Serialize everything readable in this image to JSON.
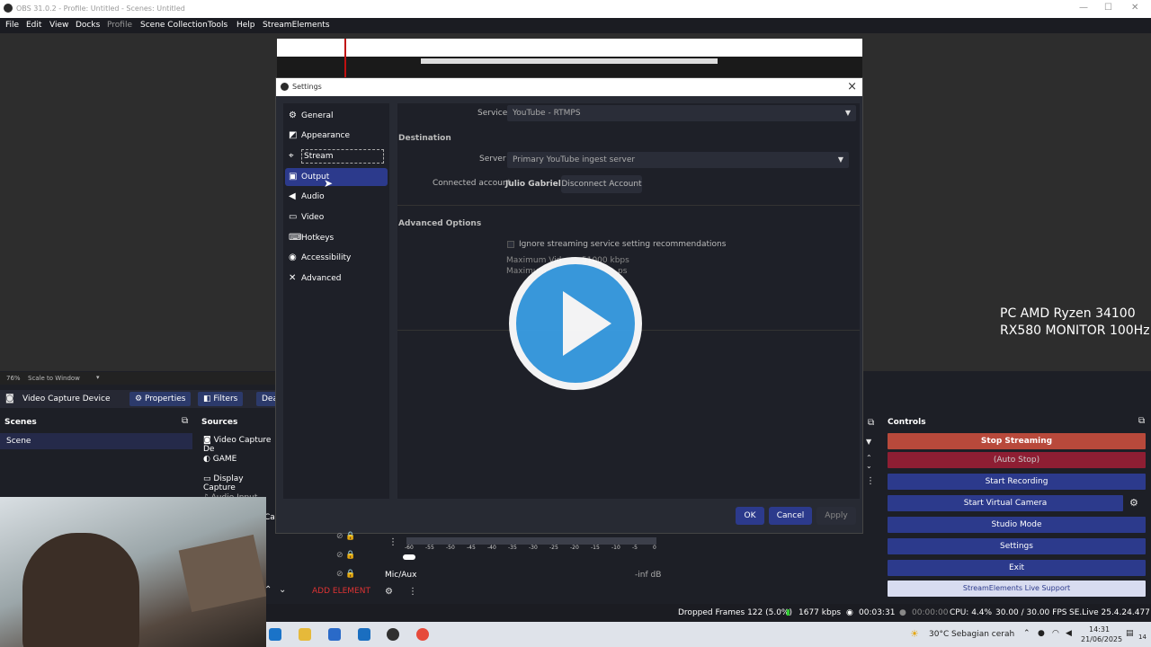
{
  "app": {
    "title": "OBS 31.0.2 - Profile: Untitled - Scenes: Untitled"
  },
  "menu": [
    "File",
    "Edit",
    "View",
    "Docks",
    "Profile",
    "Scene Collection",
    "Tools",
    "Help",
    "StreamElements"
  ],
  "preview": {
    "zoom": "76%",
    "scale_mode": "Scale to Window"
  },
  "overlay": {
    "line1": "PC AMD Ryzen 34100",
    "line2": "RX580 MONITOR 100Hz"
  },
  "source_toolbar": {
    "selected": "Video Capture Device",
    "properties": "Properties",
    "filters": "Filters",
    "deactivate": "Dea"
  },
  "scenes": {
    "title": "Scenes",
    "items": [
      "Scene"
    ]
  },
  "sources": {
    "title": "Sources",
    "items": [
      "Video Capture De",
      "GAME",
      "Display Capture",
      "Audio Input Capt",
      "Ca"
    ]
  },
  "settings": {
    "title": "Settings",
    "nav": [
      "General",
      "Appearance",
      "Stream",
      "Output",
      "Audio",
      "Video",
      "Hotkeys",
      "Accessibility",
      "Advanced"
    ],
    "service_label": "Service",
    "service_value": "YouTube - RTMPS",
    "destination": "Destination",
    "server_label": "Server",
    "server_value": "Primary YouTube ingest server",
    "account_label": "Connected account",
    "account_value": "Julio Gabriel",
    "disconnect": "Disconnect Account",
    "advanced": "Advanced Options",
    "ignore": "Ignore streaming service setting recommendations",
    "max_video": "Maximum Vid",
    "max_video_val": "51000 kbps",
    "max_audio": "Maximum",
    "max_audio_val": "ps",
    "ok": "OK",
    "cancel": "Cancel",
    "apply": "Apply"
  },
  "controls": {
    "title": "Controls",
    "buttons": [
      "Stop Streaming",
      "(Auto Stop)",
      "Start Recording",
      "Start Virtual Camera",
      "Studio Mode",
      "Settings",
      "Exit",
      "StreamElements Live Support"
    ]
  },
  "mixer": {
    "ticks": [
      "-60",
      "-55",
      "-50",
      "-45",
      "-40",
      "-35",
      "-30",
      "-25",
      "-20",
      "-15",
      "-10",
      "-5",
      "0"
    ],
    "channel": "Mic/Aux",
    "level": "-inf dB",
    "add": "ADD ELEMENT"
  },
  "status": {
    "dropped": "Dropped Frames 122 (5.0%)",
    "bitrate": "1677 kbps",
    "stream_time": "00:03:31",
    "rec_time": "00:00:00",
    "cpu": "CPU: 4.4%",
    "fps": "30.00 / 30.00 FPS",
    "se": "SE.Live 25.4.24.477"
  },
  "taskbar": {
    "weather": "30°C",
    "weather_desc": "Sebagian cerah",
    "time": "14:31",
    "date": "21/06/2025",
    "notif": "14"
  },
  "colors": {
    "accent": "#2c3a8c",
    "stop": "#b8493b",
    "autostop": "#8e1e33",
    "play": "#3a9ee4"
  }
}
